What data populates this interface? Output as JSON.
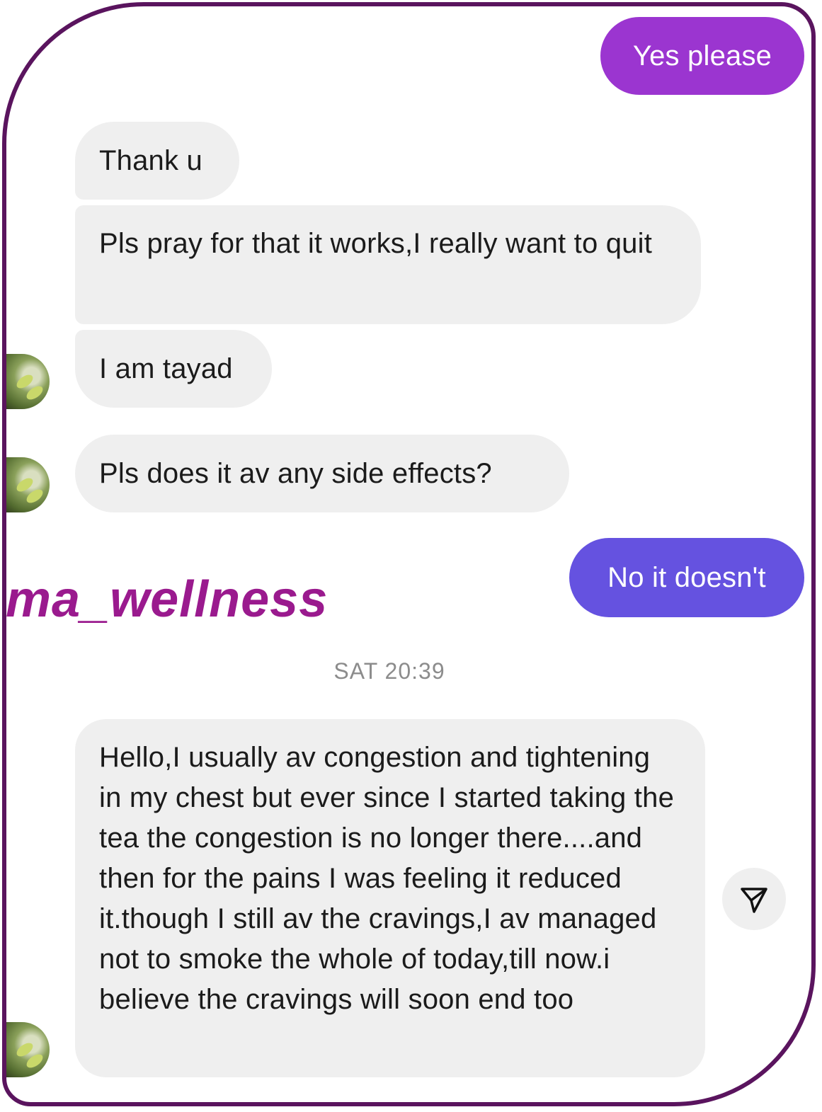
{
  "messages": {
    "out_1": "Yes please",
    "in_1": "Thank u",
    "in_2": "Pls pray for that it works,I really want to quit",
    "in_3": "I am tayad",
    "in_4": "Pls does it av any side effects?",
    "out_2": "No it doesn't",
    "timestamp": "SAT 20:39",
    "in_5": "Hello,I usually av congestion and tightening in my chest but ever since I started taking the tea the congestion is no longer there....and then for the pains I was feeling it reduced it.though I still av the cravings,I av managed not to smoke the whole of today,till now.i believe the cravings will soon end too"
  },
  "watermark": "ma_wellness",
  "colors": {
    "outgoing_gradient_top": "#9b35d0",
    "outgoing_gradient_bottom": "#6552e0",
    "incoming_bubble": "#efefef",
    "frame_border": "#5a145e",
    "watermark": "#9a1a8e"
  },
  "icons": {
    "share": "paper-plane-icon",
    "avatar": "profile-avatar-icon"
  }
}
